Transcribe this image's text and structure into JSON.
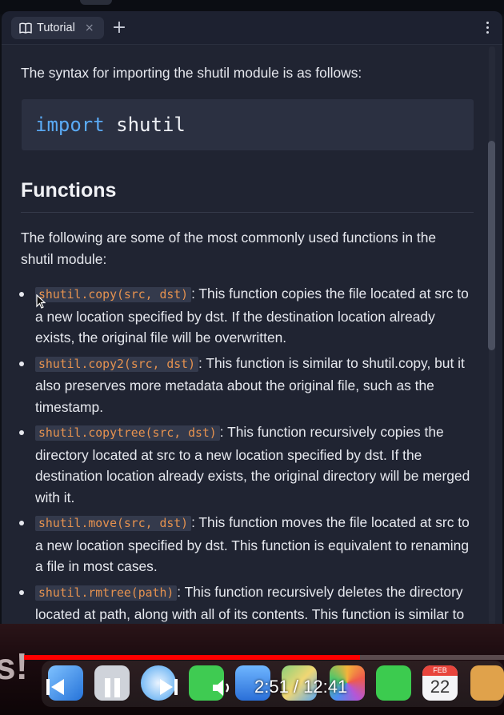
{
  "tab": {
    "title": "Tutorial",
    "close": "×",
    "new_tab": "+"
  },
  "intro_text": "The syntax for importing the shutil module is as follows:",
  "code": {
    "keyword": "import",
    "module": "shutil"
  },
  "section_heading": "Functions",
  "section_intro": "The following are some of the most commonly used functions in the shutil module:",
  "functions": [
    {
      "code": "shutil.copy(src, dst)",
      "desc": ": This function copies the file located at src to a new location specified by dst. If the destination location already exists, the original file will be overwritten."
    },
    {
      "code": "shutil.copy2(src, dst)",
      "desc": ": This function is similar to shutil.copy, but it also preserves more metadata about the original file, such as the timestamp."
    },
    {
      "code": "shutil.copytree(src, dst)",
      "desc": ": This function recursively copies the directory located at src to a new location specified by dst. If the destination location already exists, the original directory will be merged with it."
    },
    {
      "code": "shutil.move(src, dst)",
      "desc": ": This function moves the file located at src to a new location specified by dst. This function is equivalent to renaming a file in most cases."
    },
    {
      "code": "shutil.rmtree(path)",
      "desc": ": This function recursively deletes the directory located at path, along with all of its contents. This function is similar to using the rm -rf command in a shell."
    }
  ],
  "video": {
    "time": "2:51 / 12:41",
    "progress": 0.7,
    "partial_text": "s!"
  },
  "dock": {
    "calendar_month": "FEB",
    "calendar_day": "22"
  },
  "colors": {
    "accent_code": "#e6924f",
    "keyword": "#5aaaf5",
    "progress": "#ff0000"
  }
}
